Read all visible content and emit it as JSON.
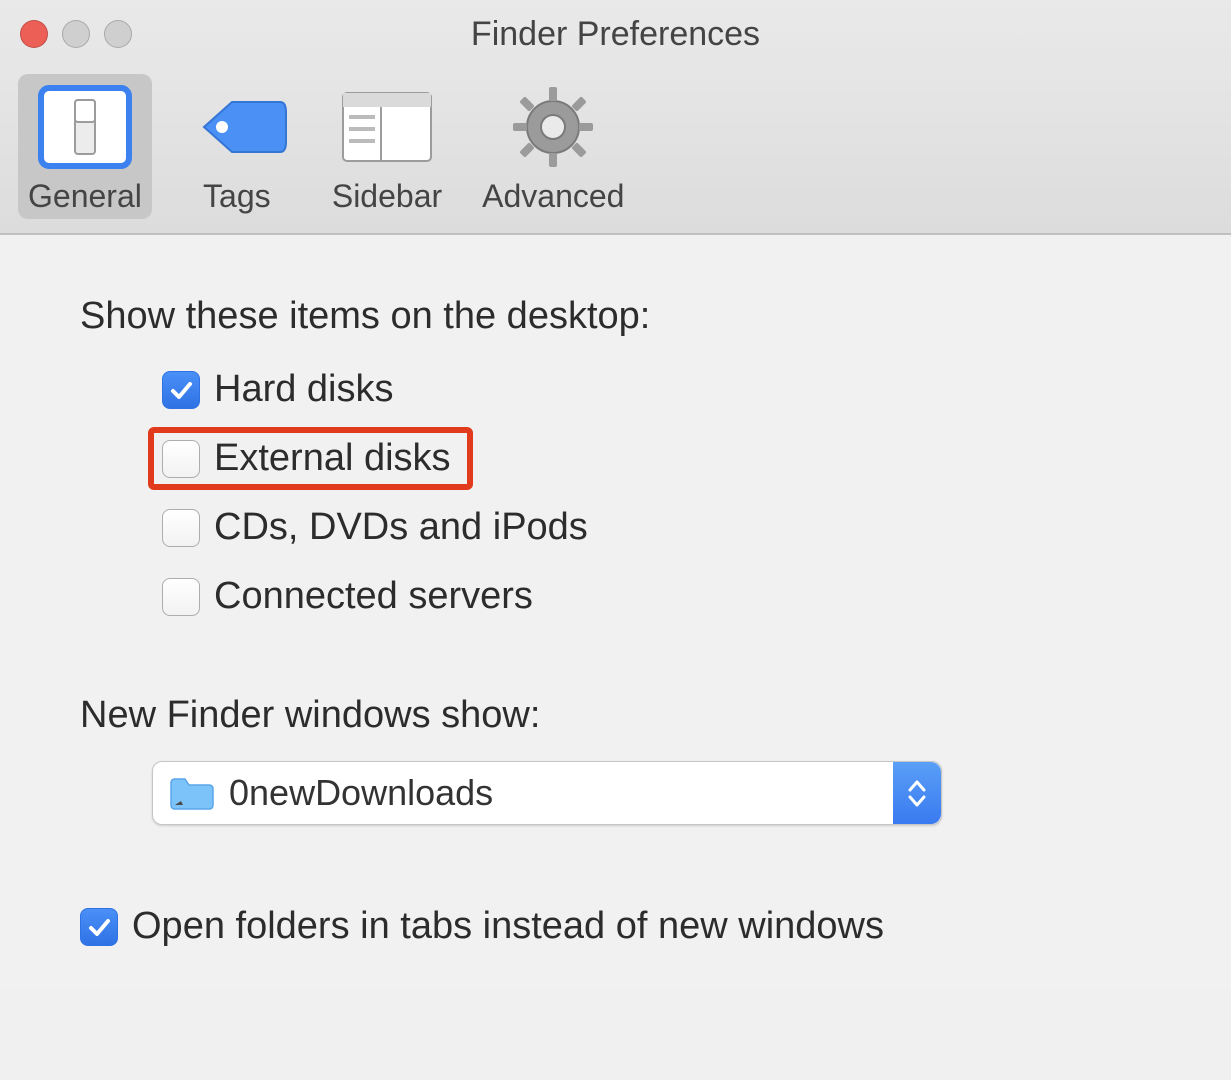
{
  "window": {
    "title": "Finder Preferences"
  },
  "tabs": [
    {
      "label": "General",
      "icon": "switch-icon"
    },
    {
      "label": "Tags",
      "icon": "tag-icon"
    },
    {
      "label": "Sidebar",
      "icon": "sidebar-icon"
    },
    {
      "label": "Advanced",
      "icon": "gear-icon"
    }
  ],
  "section_desktop": {
    "heading": "Show these items on the desktop:",
    "items": [
      {
        "label": "Hard disks",
        "checked": true
      },
      {
        "label": "External disks",
        "checked": false,
        "highlighted": true
      },
      {
        "label": "CDs, DVDs and iPods",
        "checked": false
      },
      {
        "label": "Connected servers",
        "checked": false
      }
    ]
  },
  "section_new_window": {
    "heading": "New Finder windows show:",
    "dropdown": {
      "value": "0newDownloads",
      "icon": "folder-icon"
    }
  },
  "open_in_tabs": {
    "label": "Open folders in tabs instead of new windows",
    "checked": true
  }
}
